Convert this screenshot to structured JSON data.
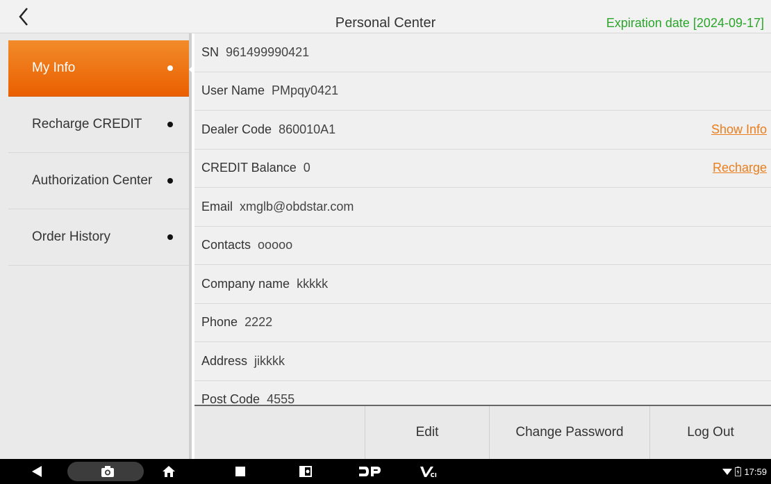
{
  "header": {
    "title": "Personal Center",
    "expiration": "Expiration date [2024-09-17]",
    "expiration_color": "#2aa52a"
  },
  "sidebar": {
    "items": [
      {
        "label": "My Info",
        "active": true
      },
      {
        "label": "Recharge CREDIT",
        "active": false
      },
      {
        "label": "Authorization Center",
        "active": false
      },
      {
        "label": "Order History",
        "active": false
      }
    ]
  },
  "info": {
    "sn": {
      "key": "SN",
      "value": "961499990421"
    },
    "user_name": {
      "key": "User Name",
      "value": "PMpqy0421"
    },
    "dealer_code": {
      "key": "Dealer Code",
      "value": "860010A1",
      "action": "Show Info"
    },
    "credit_balance": {
      "key": "CREDIT Balance",
      "value": "0",
      "action": "Recharge"
    },
    "email": {
      "key": "Email",
      "value": "xmglb@obdstar.com"
    },
    "contacts": {
      "key": "Contacts",
      "value": "ooooo"
    },
    "company_name": {
      "key": "Company name",
      "value": "kkkkk"
    },
    "phone": {
      "key": "Phone",
      "value": "2222"
    },
    "address": {
      "key": "Address",
      "value": "jikkkk"
    },
    "post_code": {
      "key": "Post Code",
      "value": "4555"
    }
  },
  "buttons": {
    "edit": "Edit",
    "change_password": "Change Password",
    "log_out": "Log Out"
  },
  "navbar": {
    "time": "17:59",
    "icons": [
      "back-icon",
      "screenshot-icon",
      "home-icon",
      "recent-apps-icon",
      "app-icon",
      "dp-icon",
      "vci-icon",
      "wifi-icon",
      "battery-icon"
    ]
  },
  "colors": {
    "accent": "#ea6c0c",
    "link": "#ea7d1c"
  }
}
